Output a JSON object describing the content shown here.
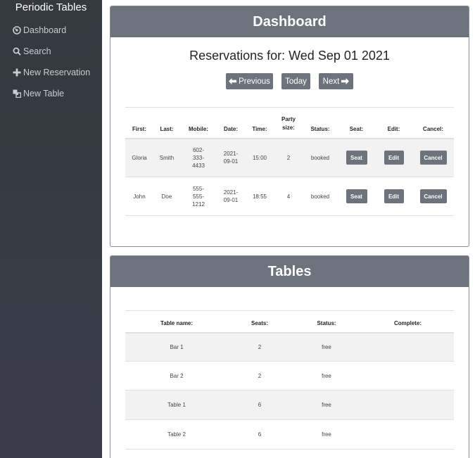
{
  "sidebar": {
    "brand": "Periodic Tables",
    "items": [
      {
        "label": "Dashboard",
        "icon": "dashboard-icon"
      },
      {
        "label": "Search",
        "icon": "search-icon"
      },
      {
        "label": "New Reservation",
        "icon": "plus-icon"
      },
      {
        "label": "New Table",
        "icon": "table-icon"
      }
    ]
  },
  "dashboard": {
    "title": "Dashboard",
    "reservations_heading": "Reservations for: Wed Sep 01 2021",
    "nav_buttons": {
      "previous": "Previous",
      "today": "Today",
      "next": "Next"
    },
    "columns": {
      "first": "First:",
      "last": "Last:",
      "mobile": "Mobile:",
      "date": "Date:",
      "time": "Time:",
      "party_1": "Party",
      "party_2": "size:",
      "status": "Status:",
      "seat": "Seat:",
      "edit": "Edit:",
      "cancel": "Cancel:"
    },
    "rows": [
      {
        "first": "Gloria",
        "last": "Smith",
        "mobile": [
          "602-",
          "333-",
          "4433"
        ],
        "date": [
          "2021-",
          "09-01"
        ],
        "time": "15:00",
        "party": "2",
        "status": "booked",
        "seat": "Seat",
        "edit": "Edit",
        "cancel": "Cancel"
      },
      {
        "first": "John",
        "last": "Doe",
        "mobile": [
          "555-",
          "555-",
          "1212"
        ],
        "date": [
          "2021-",
          "09-01"
        ],
        "time": "18:55",
        "party": "4",
        "status": "booked",
        "seat": "Seat",
        "edit": "Edit",
        "cancel": "Cancel"
      }
    ]
  },
  "tables": {
    "title": "Tables",
    "columns": {
      "name": "Table name:",
      "seats": "Seats:",
      "status": "Status:",
      "complete": "Complete:"
    },
    "rows": [
      {
        "name": "Bar 1",
        "seats": "2",
        "status": "free"
      },
      {
        "name": "Bar 2",
        "seats": "2",
        "status": "free"
      },
      {
        "name": "Table 1",
        "seats": "6",
        "status": "free"
      },
      {
        "name": "Table 2",
        "seats": "6",
        "status": "free"
      }
    ]
  },
  "colors": {
    "sidebar": "#343a40",
    "header": "#6c737c",
    "button": "#6c737c",
    "stripe": "#f2f2f2"
  }
}
